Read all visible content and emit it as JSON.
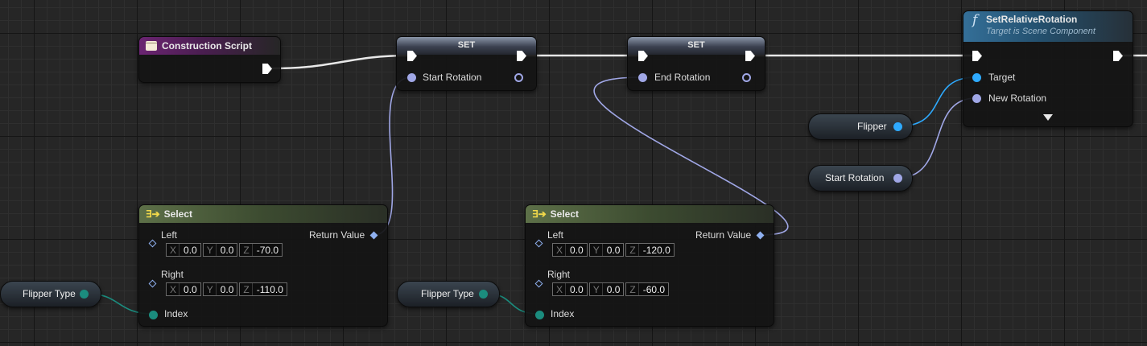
{
  "colors": {
    "exec_pin": "#ffffff",
    "rotator_pin": "#a0a7e6",
    "object_pin": "#2eaaff",
    "byte_pin": "#1b8c7e",
    "entry_header": "#6b2472",
    "function_header": "#346f98",
    "pure_header": "#5d7048"
  },
  "construction_script": {
    "title": "Construction Script",
    "icon": "script-icon"
  },
  "set_start": {
    "title": "SET",
    "pin_label": "Start Rotation"
  },
  "set_end": {
    "title": "SET",
    "pin_label": "End Rotation"
  },
  "set_relative_rotation": {
    "title": "SetRelativeRotation",
    "subtitle": "Target is Scene Component",
    "icon": "function-icon",
    "icon_glyph": "f",
    "target_label": "Target",
    "new_rotation_label": "New Rotation"
  },
  "get_flipper": {
    "label": "Flipper"
  },
  "get_start_rotation": {
    "label": "Start Rotation"
  },
  "select_1": {
    "title": "Select",
    "icon_glyph": "∃➔",
    "left_label": "Left",
    "left": {
      "x": "0.0",
      "y": "0.0",
      "z": "-70.0"
    },
    "right_label": "Right",
    "right": {
      "x": "0.0",
      "y": "0.0",
      "z": "-110.0"
    },
    "return_label": "Return Value",
    "index_label": "Index"
  },
  "select_2": {
    "title": "Select",
    "icon_glyph": "∃➔",
    "left_label": "Left",
    "left": {
      "x": "0.0",
      "y": "0.0",
      "z": "-120.0"
    },
    "right_label": "Right",
    "right": {
      "x": "0.0",
      "y": "0.0",
      "z": "-60.0"
    },
    "return_label": "Return Value",
    "index_label": "Index"
  },
  "get_flipper_type_1": {
    "label": "Flipper Type"
  },
  "get_flipper_type_2": {
    "label": "Flipper Type"
  },
  "axis_labels": {
    "x": "X",
    "y": "Y",
    "z": "Z"
  }
}
